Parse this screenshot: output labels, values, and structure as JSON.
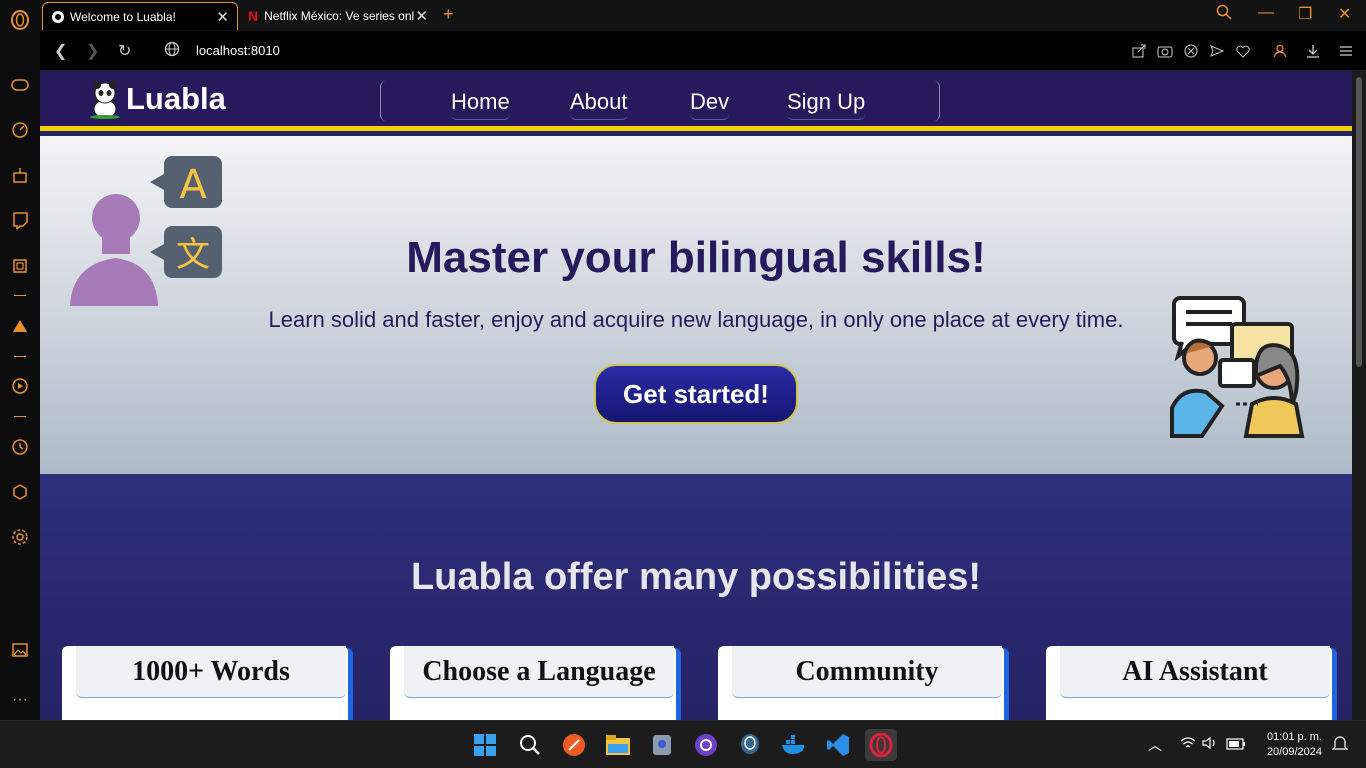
{
  "browser": {
    "tabs": [
      {
        "label": "Welcome to Luabla!",
        "active": true
      },
      {
        "label": "Netflix México: Ve series onli",
        "active": false
      }
    ],
    "url": "localhost:8010"
  },
  "site": {
    "logo_text": "Luabla",
    "nav": [
      "Home",
      "About",
      "Dev",
      "Sign Up"
    ],
    "hero": {
      "title": "Master your bilingual skills!",
      "subtitle": "Learn solid and faster, enjoy and acquire new language, in only one place at every time.",
      "cta_label": "Get started!"
    },
    "features": {
      "heading": "Luabla offer many possibilities!",
      "cards": [
        "1000+ Words",
        "Choose a Language",
        "Community",
        "AI Assistant"
      ]
    }
  },
  "taskbar": {
    "time": "01:01 p. m.",
    "date": "20/09/2024"
  },
  "colors": {
    "accent": "#e8902a",
    "nav_bg": "#26195c",
    "nav_border": "#f5d000",
    "section_bg": "#252466",
    "card_shadow": "#1d66e0"
  }
}
